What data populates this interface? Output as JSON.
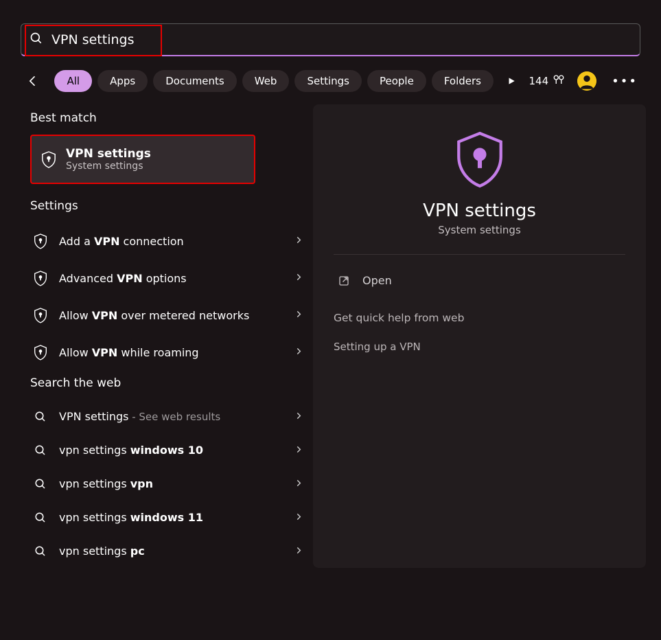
{
  "search": {
    "value": "VPN settings"
  },
  "filters": {
    "all": "All",
    "apps": "Apps",
    "documents": "Documents",
    "web": "Web",
    "settings": "Settings",
    "people": "People",
    "folders": "Folders"
  },
  "header": {
    "points": "144"
  },
  "sections": {
    "best_match": "Best match",
    "settings": "Settings",
    "search_web": "Search the web"
  },
  "best_match": {
    "title": "VPN settings",
    "subtitle": "System settings"
  },
  "settings_results": [
    {
      "prefix": "Add a ",
      "bold": "VPN",
      "suffix": " connection"
    },
    {
      "prefix": "Advanced ",
      "bold": "VPN",
      "suffix": " options"
    },
    {
      "prefix": "Allow ",
      "bold": "VPN",
      "suffix": " over metered networks"
    },
    {
      "prefix": "Allow ",
      "bold": "VPN",
      "suffix": " while roaming"
    }
  ],
  "web_results": [
    {
      "main": "VPN settings",
      "extra": " - See web results"
    },
    {
      "prefix": "vpn settings ",
      "bold": "windows 10",
      "suffix": ""
    },
    {
      "prefix": "vpn settings ",
      "bold": "vpn",
      "suffix": ""
    },
    {
      "prefix": "vpn settings ",
      "bold": "windows 11",
      "suffix": ""
    },
    {
      "prefix": "vpn settings ",
      "bold": "pc",
      "suffix": ""
    }
  ],
  "preview": {
    "title": "VPN settings",
    "subtitle": "System settings",
    "open": "Open",
    "help_head": "Get quick help from web",
    "help_link_1": "Setting up a VPN"
  }
}
